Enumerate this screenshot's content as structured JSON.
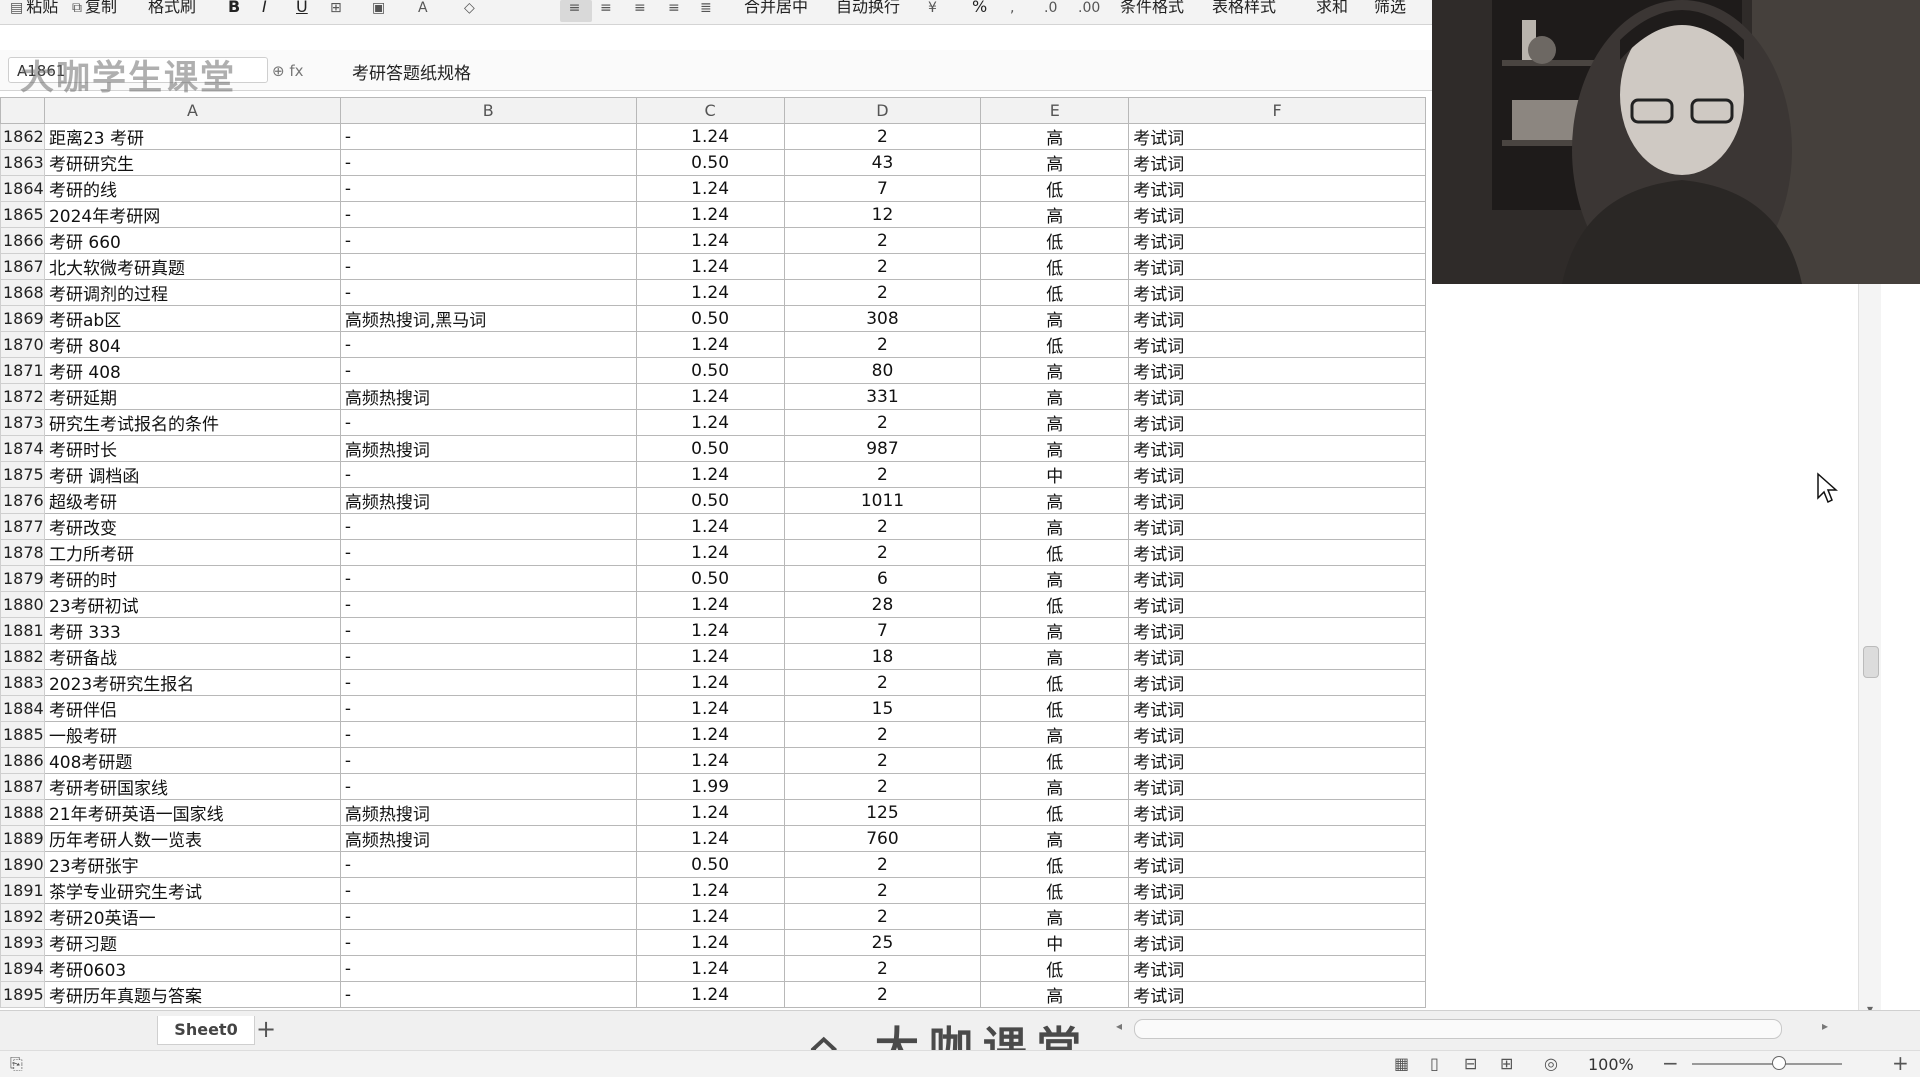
{
  "ribbon": {
    "items": [
      {
        "label": "粘贴",
        "icon": "paste-icon"
      },
      {
        "label": "复制",
        "icon": "copy-icon"
      },
      {
        "label": "格式刷",
        "icon": "format-painter-icon"
      },
      {
        "label": "B",
        "icon": "bold-icon"
      },
      {
        "label": "I",
        "icon": "italic-icon"
      },
      {
        "label": "U",
        "icon": "underline-icon"
      },
      {
        "label": "合并居中",
        "icon": "merge-center-icon"
      },
      {
        "label": "自动换行",
        "icon": "wrap-text-icon"
      },
      {
        "label": "%",
        "icon": "percent-icon"
      },
      {
        "label": "条件格式",
        "icon": "conditional-format-icon"
      },
      {
        "label": "表格样式",
        "icon": "table-style-icon"
      },
      {
        "label": "求和",
        "icon": "sum-icon"
      },
      {
        "label": "筛选",
        "icon": "filter-icon"
      }
    ]
  },
  "formula_bar": {
    "name_box": "A1861",
    "formula": "考研答题纸规格"
  },
  "watermark": {
    "top": "大咖学生课堂",
    "bottom": "大咖课堂"
  },
  "columns": [
    "A",
    "B",
    "C",
    "D",
    "E",
    "F"
  ],
  "rows": [
    {
      "n": "1862",
      "a": "距离23 考研",
      "b": "-",
      "c": "1.24",
      "d": "2",
      "e": "高",
      "f": "考试词"
    },
    {
      "n": "1863",
      "a": "考研研究生",
      "b": "-",
      "c": "0.50",
      "d": "43",
      "e": "高",
      "f": "考试词"
    },
    {
      "n": "1864",
      "a": "考研的线",
      "b": "-",
      "c": "1.24",
      "d": "7",
      "e": "低",
      "f": "考试词"
    },
    {
      "n": "1865",
      "a": "2024年考研网",
      "b": "-",
      "c": "1.24",
      "d": "12",
      "e": "高",
      "f": "考试词"
    },
    {
      "n": "1866",
      "a": "考研 660",
      "b": "-",
      "c": "1.24",
      "d": "2",
      "e": "低",
      "f": "考试词"
    },
    {
      "n": "1867",
      "a": "北大软微考研真题",
      "b": "-",
      "c": "1.24",
      "d": "2",
      "e": "低",
      "f": "考试词"
    },
    {
      "n": "1868",
      "a": "考研调剂的过程",
      "b": "-",
      "c": "1.24",
      "d": "2",
      "e": "低",
      "f": "考试词"
    },
    {
      "n": "1869",
      "a": "考研ab区",
      "b": "高频热搜词,黑马词",
      "c": "0.50",
      "d": "308",
      "e": "高",
      "f": "考试词"
    },
    {
      "n": "1870",
      "a": "考研 804",
      "b": "-",
      "c": "1.24",
      "d": "2",
      "e": "低",
      "f": "考试词"
    },
    {
      "n": "1871",
      "a": "考研 408",
      "b": "-",
      "c": "0.50",
      "d": "80",
      "e": "高",
      "f": "考试词"
    },
    {
      "n": "1872",
      "a": "考研延期",
      "b": "高频热搜词",
      "c": "1.24",
      "d": "331",
      "e": "高",
      "f": "考试词"
    },
    {
      "n": "1873",
      "a": "研究生考试报名的条件",
      "b": "-",
      "c": "1.24",
      "d": "2",
      "e": "高",
      "f": "考试词"
    },
    {
      "n": "1874",
      "a": "考研时长",
      "b": "高频热搜词",
      "c": "0.50",
      "d": "987",
      "e": "高",
      "f": "考试词"
    },
    {
      "n": "1875",
      "a": "考研 调档函",
      "b": "-",
      "c": "1.24",
      "d": "2",
      "e": "中",
      "f": "考试词"
    },
    {
      "n": "1876",
      "a": "超级考研",
      "b": "高频热搜词",
      "c": "0.50",
      "d": "1011",
      "e": "高",
      "f": "考试词"
    },
    {
      "n": "1877",
      "a": "考研改变",
      "b": "-",
      "c": "1.24",
      "d": "2",
      "e": "高",
      "f": "考试词"
    },
    {
      "n": "1878",
      "a": "工力所考研",
      "b": "-",
      "c": "1.24",
      "d": "2",
      "e": "低",
      "f": "考试词"
    },
    {
      "n": "1879",
      "a": "考研的时",
      "b": "-",
      "c": "0.50",
      "d": "6",
      "e": "高",
      "f": "考试词"
    },
    {
      "n": "1880",
      "a": "23考研初试",
      "b": "-",
      "c": "1.24",
      "d": "28",
      "e": "低",
      "f": "考试词"
    },
    {
      "n": "1881",
      "a": "考研 333",
      "b": "-",
      "c": "1.24",
      "d": "7",
      "e": "高",
      "f": "考试词"
    },
    {
      "n": "1882",
      "a": "考研备战",
      "b": "-",
      "c": "1.24",
      "d": "18",
      "e": "高",
      "f": "考试词"
    },
    {
      "n": "1883",
      "a": "2023考研究生报名",
      "b": "-",
      "c": "1.24",
      "d": "2",
      "e": "低",
      "f": "考试词"
    },
    {
      "n": "1884",
      "a": "考研伴侣",
      "b": "-",
      "c": "1.24",
      "d": "15",
      "e": "低",
      "f": "考试词"
    },
    {
      "n": "1885",
      "a": "一般考研",
      "b": "-",
      "c": "1.24",
      "d": "2",
      "e": "高",
      "f": "考试词"
    },
    {
      "n": "1886",
      "a": "408考研题",
      "b": "-",
      "c": "1.24",
      "d": "2",
      "e": "低",
      "f": "考试词"
    },
    {
      "n": "1887",
      "a": "考研考研国家线",
      "b": "-",
      "c": "1.99",
      "d": "2",
      "e": "高",
      "f": "考试词"
    },
    {
      "n": "1888",
      "a": "21年考研英语一国家线",
      "b": "高频热搜词",
      "c": "1.24",
      "d": "125",
      "e": "低",
      "f": "考试词"
    },
    {
      "n": "1889",
      "a": "历年考研人数一览表",
      "b": "高频热搜词",
      "c": "1.24",
      "d": "760",
      "e": "高",
      "f": "考试词"
    },
    {
      "n": "1890",
      "a": "23考研张宇",
      "b": "-",
      "c": "0.50",
      "d": "2",
      "e": "低",
      "f": "考试词"
    },
    {
      "n": "1891",
      "a": "茶学专业研究生考试",
      "b": "-",
      "c": "1.24",
      "d": "2",
      "e": "低",
      "f": "考试词"
    },
    {
      "n": "1892",
      "a": "考研20英语一",
      "b": "-",
      "c": "1.24",
      "d": "2",
      "e": "高",
      "f": "考试词"
    },
    {
      "n": "1893",
      "a": "考研习题",
      "b": "-",
      "c": "1.24",
      "d": "25",
      "e": "中",
      "f": "考试词"
    },
    {
      "n": "1894",
      "a": "考研0603",
      "b": "-",
      "c": "1.24",
      "d": "2",
      "e": "低",
      "f": "考试词"
    },
    {
      "n": "1895",
      "a": "考研历年真题与答案",
      "b": "-",
      "c": "1.24",
      "d": "2",
      "e": "高",
      "f": "考试词"
    }
  ],
  "sheet_tab": "Sheet0",
  "add_sheet": "+",
  "status": {
    "zoom": "100%",
    "zoom_out": "−",
    "zoom_in": "+"
  },
  "colors": {
    "grid": "#b8b8b8",
    "header_bg": "#f2f2f2",
    "ribbon_bg": "#f3f3f3"
  }
}
